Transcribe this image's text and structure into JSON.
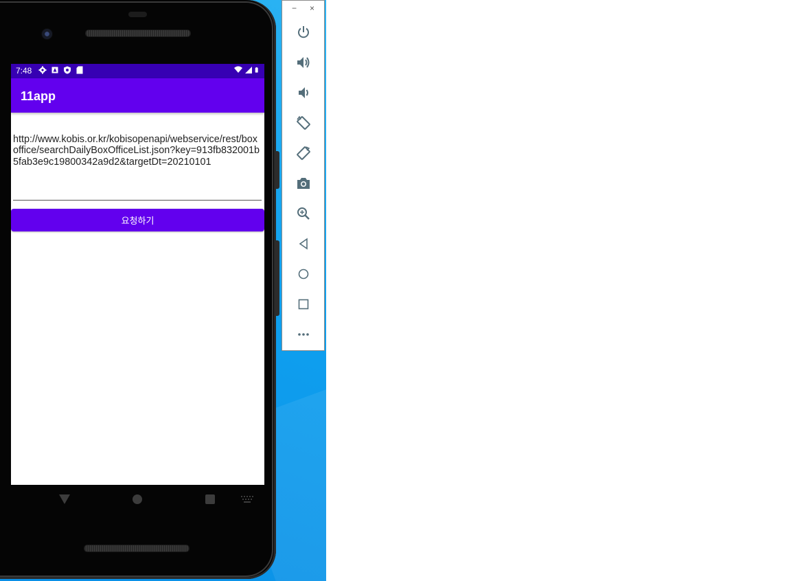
{
  "status_bar": {
    "time": "7:48",
    "left_icons": [
      "settings-icon",
      "alert-icon",
      "shield-icon",
      "sd-card-icon"
    ],
    "right_icons": [
      "wifi-icon",
      "signal-icon",
      "battery-icon"
    ]
  },
  "app": {
    "title": "11app",
    "url_value": "http://www.kobis.or.kr/kobisopenapi/webservice/rest/boxoffice/searchDailyBoxOfficeList.json?key=913fb832001b5fab3e9c19800342a9d2&targetDt=20210101",
    "request_button_label": "요청하기",
    "colors": {
      "primary": "#6200ee",
      "primary_dark": "#3700b3"
    }
  },
  "nav_bar": {
    "items": [
      "back-icon",
      "home-icon",
      "recents-icon",
      "keyboard-icon"
    ]
  },
  "emulator_toolbar": {
    "minimize_label": "−",
    "close_label": "×",
    "buttons": [
      "power-icon",
      "volume-up-icon",
      "volume-down-icon",
      "rotate-left-icon",
      "rotate-right-icon",
      "camera-icon",
      "zoom-icon",
      "back-icon",
      "home-icon",
      "overview-icon",
      "more-icon"
    ]
  }
}
